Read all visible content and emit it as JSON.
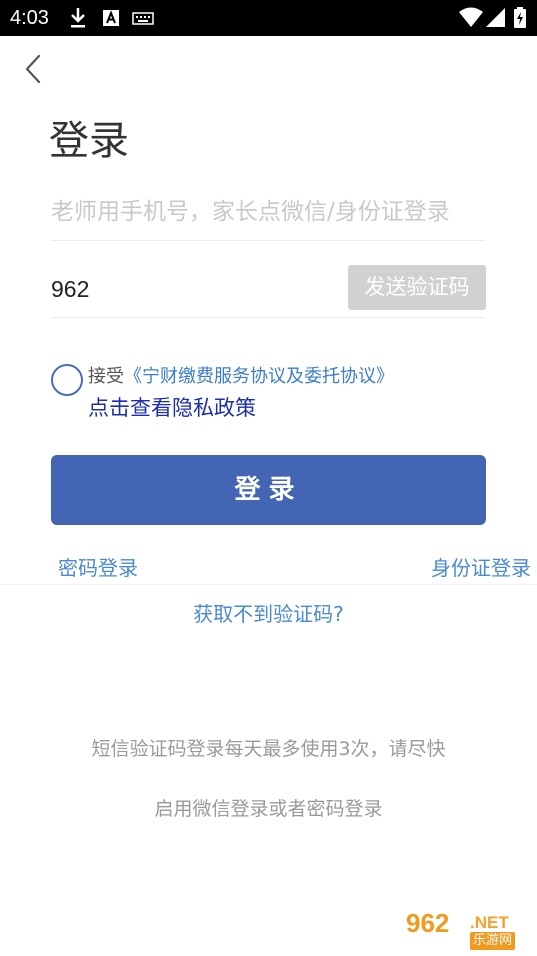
{
  "status_bar": {
    "time": "4:03",
    "icons": [
      "download-icon",
      "a-font-icon",
      "keyboard-icon",
      "wifi-icon",
      "signal-icon",
      "battery-icon"
    ]
  },
  "header": {
    "back_icon": "chevron-left-icon",
    "title": "登录"
  },
  "form": {
    "phone_placeholder": "老师用手机号，家长点微信/身份证登录",
    "code_value": "962",
    "send_code_label": "发送验证码",
    "agreement_prefix": "接受",
    "agreement_link": "《宁财缴费服务协议及委托协议》",
    "privacy_link": "点击查看隐私政策",
    "login_label": "登录"
  },
  "links": {
    "password_login": "密码登录",
    "id_card_login": "身份证登录",
    "no_code": "获取不到验证码?"
  },
  "notes": {
    "line1": "短信验证码登录每天最多使用3次，请尽快",
    "line2": "启用微信登录或者密码登录"
  },
  "watermark": {
    "brand_number": "962",
    "brand_suffix": ".NET",
    "brand_subtitle": "乐游网"
  },
  "colors": {
    "primary_button": "#4365b3",
    "link": "#4a8ad0",
    "privacy_link": "#1b2fb0",
    "send_button_disabled": "#d1d1d1",
    "status_bar": "#000000"
  }
}
